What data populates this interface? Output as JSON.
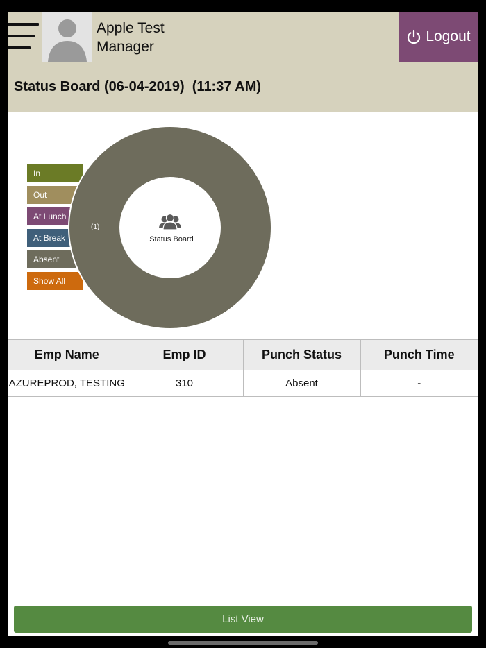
{
  "header": {
    "user_name_line1": "Apple Test",
    "user_name_line2": "Manager",
    "logout_label": "Logout"
  },
  "title": "Status Board (06-04-2019)  (11:37 AM)",
  "legend": [
    {
      "label": "In",
      "color": "#6b7b26"
    },
    {
      "label": "Out",
      "color": "#a08e5e"
    },
    {
      "label": "At Lunch",
      "color": "#7d4a74"
    },
    {
      "label": "At Break",
      "color": "#3f5f7a"
    },
    {
      "label": "Absent",
      "color": "#6e6c5c"
    },
    {
      "label": "Show All",
      "color": "#cd6a0e"
    }
  ],
  "donut": {
    "center_label": "Status Board",
    "center_icon": "people-icon",
    "segments": [
      {
        "status": "Absent",
        "count": 1,
        "count_label": "(1)",
        "color": "#6e6c5c"
      }
    ]
  },
  "table": {
    "columns": [
      "Emp Name",
      "Emp ID",
      "Punch Status",
      "Punch Time"
    ],
    "rows": [
      [
        "AZUREPROD, TESTING",
        "310",
        "Absent",
        "-"
      ]
    ]
  },
  "footer": {
    "list_view_label": "List View"
  },
  "colors": {
    "header_bg": "#d6d2bd",
    "logout_bg": "#7d4a74",
    "list_view_bg": "#558a41"
  }
}
